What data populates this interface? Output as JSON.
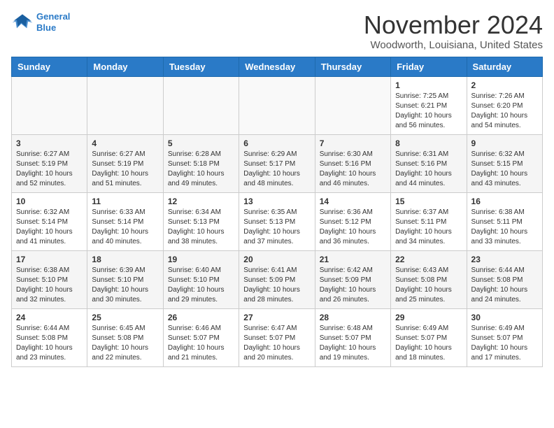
{
  "header": {
    "logo_line1": "General",
    "logo_line2": "Blue",
    "month": "November 2024",
    "location": "Woodworth, Louisiana, United States"
  },
  "weekdays": [
    "Sunday",
    "Monday",
    "Tuesday",
    "Wednesday",
    "Thursday",
    "Friday",
    "Saturday"
  ],
  "rows": [
    [
      {
        "day": "",
        "info": ""
      },
      {
        "day": "",
        "info": ""
      },
      {
        "day": "",
        "info": ""
      },
      {
        "day": "",
        "info": ""
      },
      {
        "day": "",
        "info": ""
      },
      {
        "day": "1",
        "info": "Sunrise: 7:25 AM\nSunset: 6:21 PM\nDaylight: 10 hours and 56 minutes."
      },
      {
        "day": "2",
        "info": "Sunrise: 7:26 AM\nSunset: 6:20 PM\nDaylight: 10 hours and 54 minutes."
      }
    ],
    [
      {
        "day": "3",
        "info": "Sunrise: 6:27 AM\nSunset: 5:19 PM\nDaylight: 10 hours and 52 minutes."
      },
      {
        "day": "4",
        "info": "Sunrise: 6:27 AM\nSunset: 5:19 PM\nDaylight: 10 hours and 51 minutes."
      },
      {
        "day": "5",
        "info": "Sunrise: 6:28 AM\nSunset: 5:18 PM\nDaylight: 10 hours and 49 minutes."
      },
      {
        "day": "6",
        "info": "Sunrise: 6:29 AM\nSunset: 5:17 PM\nDaylight: 10 hours and 48 minutes."
      },
      {
        "day": "7",
        "info": "Sunrise: 6:30 AM\nSunset: 5:16 PM\nDaylight: 10 hours and 46 minutes."
      },
      {
        "day": "8",
        "info": "Sunrise: 6:31 AM\nSunset: 5:16 PM\nDaylight: 10 hours and 44 minutes."
      },
      {
        "day": "9",
        "info": "Sunrise: 6:32 AM\nSunset: 5:15 PM\nDaylight: 10 hours and 43 minutes."
      }
    ],
    [
      {
        "day": "10",
        "info": "Sunrise: 6:32 AM\nSunset: 5:14 PM\nDaylight: 10 hours and 41 minutes."
      },
      {
        "day": "11",
        "info": "Sunrise: 6:33 AM\nSunset: 5:14 PM\nDaylight: 10 hours and 40 minutes."
      },
      {
        "day": "12",
        "info": "Sunrise: 6:34 AM\nSunset: 5:13 PM\nDaylight: 10 hours and 38 minutes."
      },
      {
        "day": "13",
        "info": "Sunrise: 6:35 AM\nSunset: 5:13 PM\nDaylight: 10 hours and 37 minutes."
      },
      {
        "day": "14",
        "info": "Sunrise: 6:36 AM\nSunset: 5:12 PM\nDaylight: 10 hours and 36 minutes."
      },
      {
        "day": "15",
        "info": "Sunrise: 6:37 AM\nSunset: 5:11 PM\nDaylight: 10 hours and 34 minutes."
      },
      {
        "day": "16",
        "info": "Sunrise: 6:38 AM\nSunset: 5:11 PM\nDaylight: 10 hours and 33 minutes."
      }
    ],
    [
      {
        "day": "17",
        "info": "Sunrise: 6:38 AM\nSunset: 5:10 PM\nDaylight: 10 hours and 32 minutes."
      },
      {
        "day": "18",
        "info": "Sunrise: 6:39 AM\nSunset: 5:10 PM\nDaylight: 10 hours and 30 minutes."
      },
      {
        "day": "19",
        "info": "Sunrise: 6:40 AM\nSunset: 5:10 PM\nDaylight: 10 hours and 29 minutes."
      },
      {
        "day": "20",
        "info": "Sunrise: 6:41 AM\nSunset: 5:09 PM\nDaylight: 10 hours and 28 minutes."
      },
      {
        "day": "21",
        "info": "Sunrise: 6:42 AM\nSunset: 5:09 PM\nDaylight: 10 hours and 26 minutes."
      },
      {
        "day": "22",
        "info": "Sunrise: 6:43 AM\nSunset: 5:08 PM\nDaylight: 10 hours and 25 minutes."
      },
      {
        "day": "23",
        "info": "Sunrise: 6:44 AM\nSunset: 5:08 PM\nDaylight: 10 hours and 24 minutes."
      }
    ],
    [
      {
        "day": "24",
        "info": "Sunrise: 6:44 AM\nSunset: 5:08 PM\nDaylight: 10 hours and 23 minutes."
      },
      {
        "day": "25",
        "info": "Sunrise: 6:45 AM\nSunset: 5:08 PM\nDaylight: 10 hours and 22 minutes."
      },
      {
        "day": "26",
        "info": "Sunrise: 6:46 AM\nSunset: 5:07 PM\nDaylight: 10 hours and 21 minutes."
      },
      {
        "day": "27",
        "info": "Sunrise: 6:47 AM\nSunset: 5:07 PM\nDaylight: 10 hours and 20 minutes."
      },
      {
        "day": "28",
        "info": "Sunrise: 6:48 AM\nSunset: 5:07 PM\nDaylight: 10 hours and 19 minutes."
      },
      {
        "day": "29",
        "info": "Sunrise: 6:49 AM\nSunset: 5:07 PM\nDaylight: 10 hours and 18 minutes."
      },
      {
        "day": "30",
        "info": "Sunrise: 6:49 AM\nSunset: 5:07 PM\nDaylight: 10 hours and 17 minutes."
      }
    ]
  ]
}
